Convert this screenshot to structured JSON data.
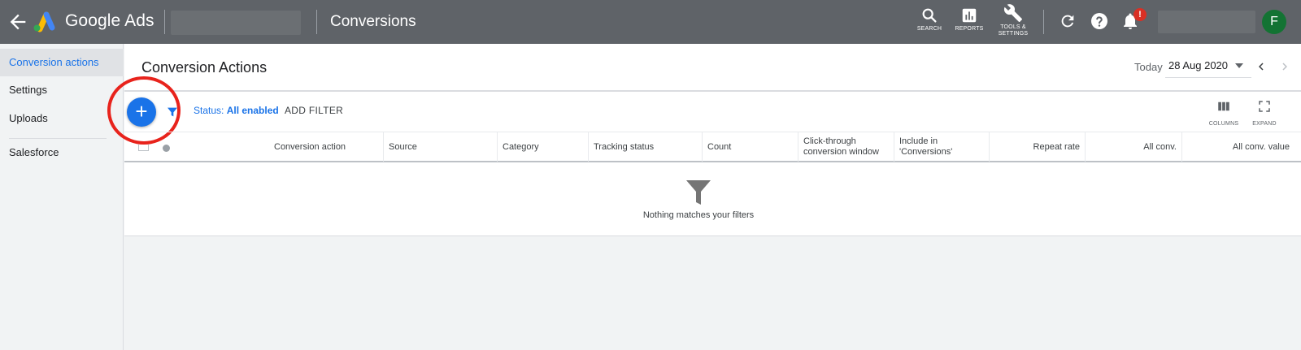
{
  "topbar": {
    "brand": "Google Ads",
    "page_heading": "Conversions",
    "tools": {
      "search_label": "SEARCH",
      "reports_label": "REPORTS",
      "tools_label_line1": "TOOLS &",
      "tools_label_line2": "SETTINGS"
    },
    "notification_badge": "!",
    "avatar_initial": "F",
    "colors": {
      "bar": "#5f6368",
      "avatar": "#137333",
      "badge": "#d93025"
    }
  },
  "sidebar": {
    "items": [
      {
        "label": "Conversion actions",
        "active": true
      },
      {
        "label": "Settings",
        "active": false
      },
      {
        "label": "Uploads",
        "active": false
      },
      {
        "label": "Salesforce",
        "active": false
      }
    ]
  },
  "main": {
    "title": "Conversion Actions",
    "date_label": "Today",
    "date_value": "28 Aug 2020",
    "filter": {
      "status_prefix": "Status:",
      "status_value": "All enabled",
      "add_filter_label": "ADD FILTER"
    },
    "table_tools": {
      "columns_label": "COLUMNS",
      "expand_label": "EXPAND"
    },
    "table_headers": [
      "Conversion action",
      "Source",
      "Category",
      "Tracking status",
      "Count",
      "Click-through conversion window",
      "Include in 'Conversions'",
      "Repeat rate",
      "All conv.",
      "All conv. value"
    ],
    "empty_message": "Nothing matches your filters",
    "colors": {
      "accent": "#1a73e8",
      "highlight_ring": "#e8231c"
    }
  }
}
